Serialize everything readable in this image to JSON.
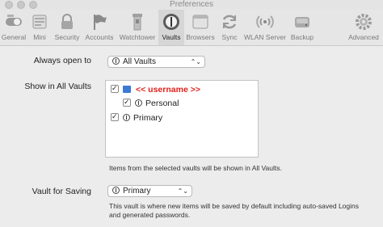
{
  "window": {
    "title": "Preferences"
  },
  "toolbar": {
    "items": [
      {
        "label": "General",
        "icon": "switch-icon"
      },
      {
        "label": "Mini",
        "icon": "mini-window-icon"
      },
      {
        "label": "Security",
        "icon": "lock-icon"
      },
      {
        "label": "Accounts",
        "icon": "flag-icon"
      },
      {
        "label": "Watchtower",
        "icon": "tower-icon"
      },
      {
        "label": "Vaults",
        "icon": "vault-icon"
      },
      {
        "label": "Browsers",
        "icon": "browsers-icon"
      },
      {
        "label": "Sync",
        "icon": "sync-icon"
      },
      {
        "label": "WLAN Server",
        "icon": "wlan-icon"
      },
      {
        "label": "Backup",
        "icon": "disk-icon"
      },
      {
        "label": "Advanced",
        "icon": "gear-icon"
      }
    ],
    "active": "Vaults"
  },
  "settings": {
    "always_open_label": "Always open to",
    "always_open_value": "All Vaults",
    "show_in_all_label": "Show in All Vaults",
    "vault_list": [
      {
        "name": "<< username >>",
        "checked": true,
        "highlight": true
      },
      {
        "name": "Personal",
        "checked": true
      },
      {
        "name": "Primary",
        "checked": true
      }
    ],
    "list_note": "Items from the selected vaults will be shown in All Vaults.",
    "vault_saving_label": "Vault for Saving",
    "vault_saving_value": "Primary",
    "saving_note_line1": "This vault is where new items will be saved by default including auto-saved Logins",
    "saving_note_line2": "and generated passwords."
  },
  "colors": {
    "highlight": "#e0201a",
    "user_vault": "#3a7bd5"
  }
}
